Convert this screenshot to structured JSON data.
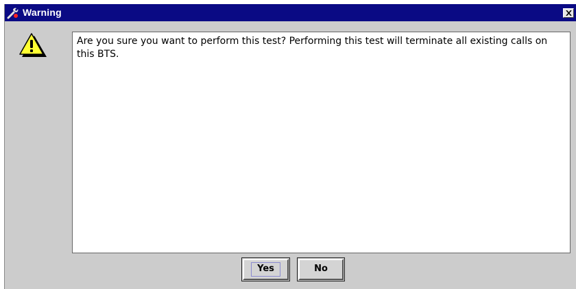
{
  "window": {
    "title": "Warning",
    "title_icon": "wrench-icon",
    "close_icon": "close-icon",
    "close_label": "Close"
  },
  "message": {
    "icon": "warning-icon",
    "text": "Are you sure you want to perform this test? Performing this test will terminate all existing calls on this BTS."
  },
  "buttons": {
    "yes_label": "Yes",
    "no_label": "No"
  },
  "colors": {
    "titlebar": "#0a0a84",
    "dialog_background": "#cccccc",
    "warning_icon_fill": "#ffff33"
  }
}
